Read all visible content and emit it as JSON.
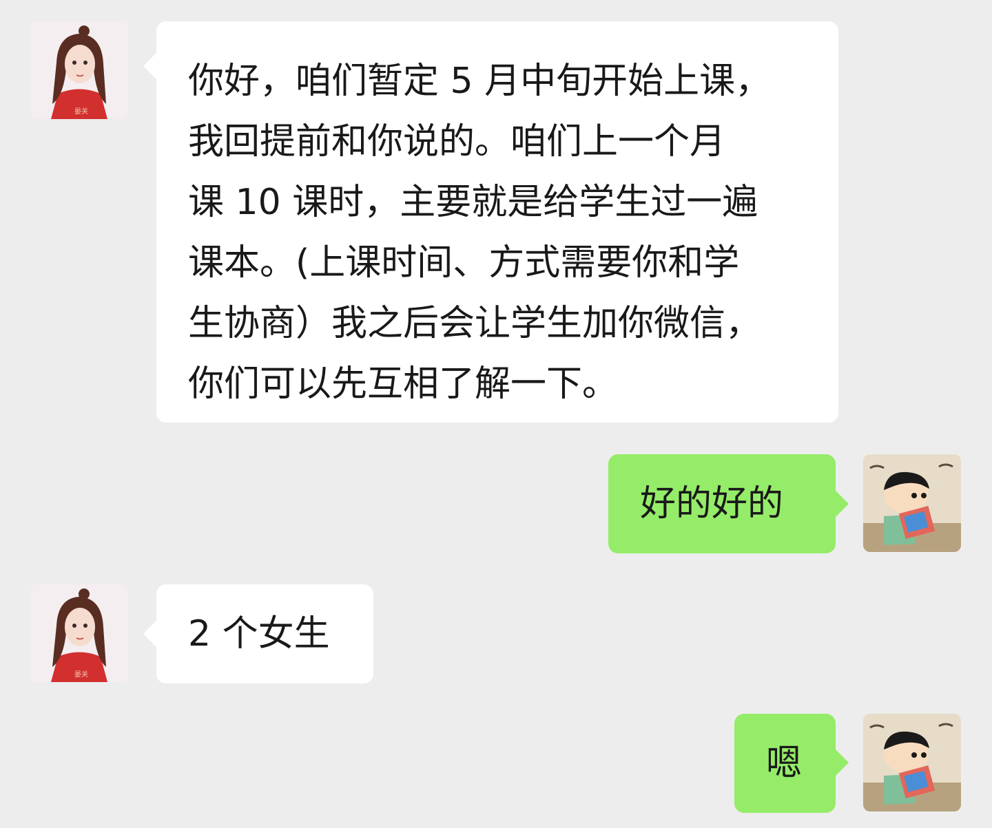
{
  "messages": [
    {
      "side": "left",
      "avatar_icon": "girl-avatar-icon",
      "text": "你好，咱们暂定 5 月中旬开始上课，\n我回提前和你说的。咱们上一个月\n课 10 课时，主要就是给学生过一遍\n课本。(上课时间、方式需要你和学\n生协商）我之后会让学生加你微信，\n你们可以先互相了解一下。"
    },
    {
      "side": "right",
      "avatar_icon": "cartoon-boy-avatar-icon",
      "text": "好的好的"
    },
    {
      "side": "left",
      "avatar_icon": "girl-avatar-icon",
      "text": "2 个女生"
    },
    {
      "side": "right",
      "avatar_icon": "cartoon-boy-avatar-icon",
      "text": "嗯"
    }
  ],
  "colors": {
    "background": "#ededed",
    "incoming_bubble": "#ffffff",
    "outgoing_bubble": "#95ec69",
    "text": "#191919"
  }
}
